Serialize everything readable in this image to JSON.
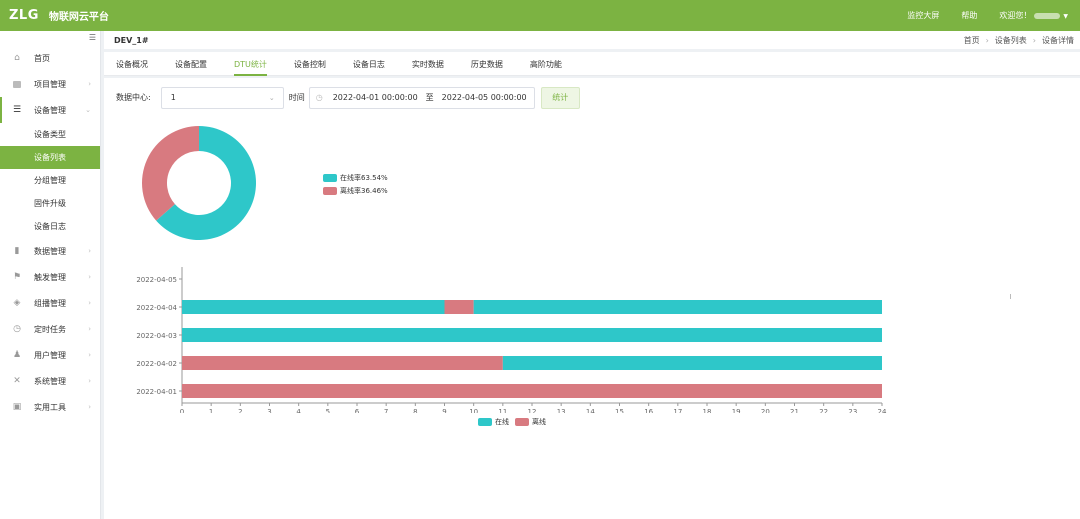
{
  "topbar": {
    "logo": "ZLG",
    "title": "物联网云平台",
    "links": [
      "监控大屏",
      "帮助"
    ],
    "welcome": "欢迎您！",
    "brand_color": "#7cb342"
  },
  "sidebar": {
    "items": [
      {
        "label": "首页",
        "icon": "home-icon"
      },
      {
        "label": "项目管理",
        "icon": "project-icon"
      },
      {
        "label": "设备管理",
        "icon": "device-icon",
        "open": true
      },
      {
        "label": "数据管理",
        "icon": "chart-icon"
      },
      {
        "label": "触发管理",
        "icon": "flag-icon"
      },
      {
        "label": "组播管理",
        "icon": "layers-icon"
      },
      {
        "label": "定时任务",
        "icon": "timer-icon"
      },
      {
        "label": "用户管理",
        "icon": "user-icon"
      },
      {
        "label": "系统管理",
        "icon": "tools-icon"
      },
      {
        "label": "实用工具",
        "icon": "toolbox-icon"
      }
    ],
    "device_sub": [
      "设备类型",
      "设备列表",
      "分组管理",
      "固件升级",
      "设备日志"
    ],
    "active_sub": "设备列表"
  },
  "header": {
    "device_title": "DEV_1#",
    "breadcrumb": [
      "首页",
      "设备列表",
      "设备详情"
    ]
  },
  "tabs": [
    "设备概况",
    "设备配置",
    "DTU统计",
    "设备控制",
    "设备日志",
    "实时数据",
    "历史数据",
    "高阶功能"
  ],
  "active_tab": "DTU统计",
  "filter": {
    "center_label": "数据中心:",
    "center_value": "1",
    "time_label": "时间",
    "start": "2022-04-01 00:00:00",
    "sep": "至",
    "end": "2022-04-05 00:00:00",
    "submit": "统计"
  },
  "chart_data": [
    {
      "type": "pie",
      "categories": [
        "在线率63.54%",
        "离线率36.46%"
      ],
      "values": [
        63.54,
        36.46
      ],
      "colors": [
        "#2ec7c9",
        "#d87a80"
      ]
    },
    {
      "type": "bar",
      "orientation": "horizontal",
      "categories": [
        "2022-04-05",
        "2022-04-04",
        "2022-04-03",
        "2022-04-02",
        "2022-04-01"
      ],
      "x_ticks": [
        "0",
        "1",
        "2",
        "3",
        "4",
        "5",
        "6",
        "7",
        "8",
        "9",
        "10",
        "11",
        "12",
        "13",
        "14",
        "15",
        "16",
        "17",
        "18",
        "19",
        "20",
        "21",
        "22",
        "23",
        "24"
      ],
      "xlim": [
        0,
        24
      ],
      "legend": [
        "在线",
        "离线"
      ],
      "legend_position": "bottom",
      "colors": {
        "在线": "#2ec7c9",
        "离线": "#d87a80"
      },
      "segments": [
        [],
        [
          {
            "state": "在线",
            "from": 0,
            "to": 9
          },
          {
            "state": "离线",
            "from": 9,
            "to": 10
          },
          {
            "state": "在线",
            "from": 10,
            "to": 24
          }
        ],
        [
          {
            "state": "在线",
            "from": 0,
            "to": 24
          }
        ],
        [
          {
            "state": "离线",
            "from": 0,
            "to": 11
          },
          {
            "state": "在线",
            "from": 11,
            "to": 24
          }
        ],
        [
          {
            "state": "离线",
            "from": 0,
            "to": 24
          }
        ]
      ]
    }
  ]
}
